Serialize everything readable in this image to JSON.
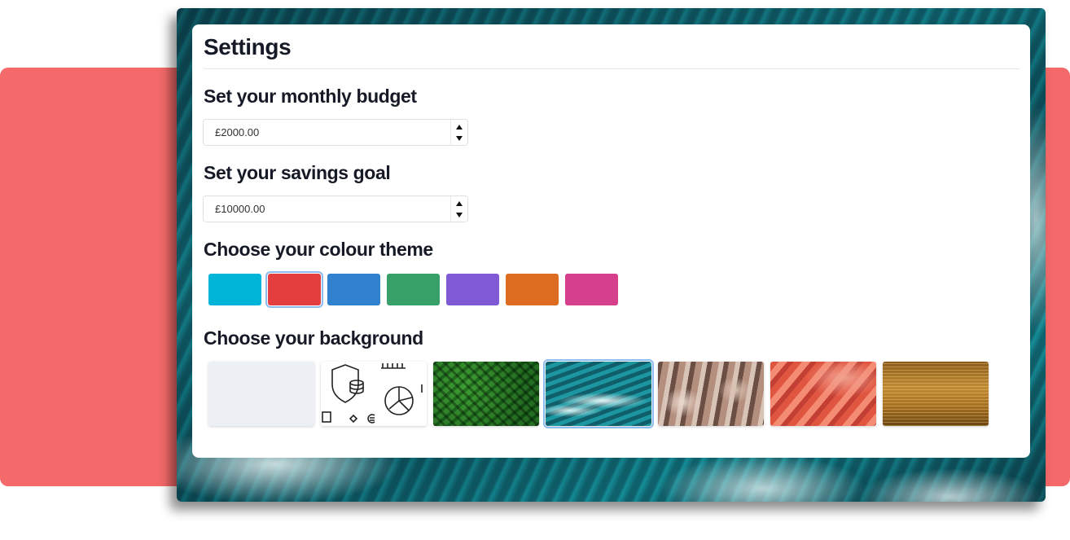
{
  "settings": {
    "title": "Settings",
    "budget": {
      "heading": "Set your monthly budget",
      "value": "£2000.00"
    },
    "savings": {
      "heading": "Set your savings goal",
      "value": "£10000.00"
    },
    "colour_theme": {
      "heading": "Choose your colour theme",
      "selected_index": 1,
      "swatches": [
        {
          "name": "cyan",
          "color": "#00b5d8"
        },
        {
          "name": "red",
          "color": "#e53e3e"
        },
        {
          "name": "blue",
          "color": "#3182ce"
        },
        {
          "name": "green",
          "color": "#38a169"
        },
        {
          "name": "purple",
          "color": "#805ad5"
        },
        {
          "name": "orange",
          "color": "#dd6b20"
        },
        {
          "name": "pink",
          "color": "#d53f8c"
        }
      ]
    },
    "background": {
      "heading": "Choose your background",
      "selected_index": 3,
      "options": [
        {
          "name": "plain-light"
        },
        {
          "name": "finance-icons"
        },
        {
          "name": "fern-leaves"
        },
        {
          "name": "ocean-waves"
        },
        {
          "name": "rocks"
        },
        {
          "name": "red-canyon"
        },
        {
          "name": "golden-water"
        }
      ]
    }
  }
}
